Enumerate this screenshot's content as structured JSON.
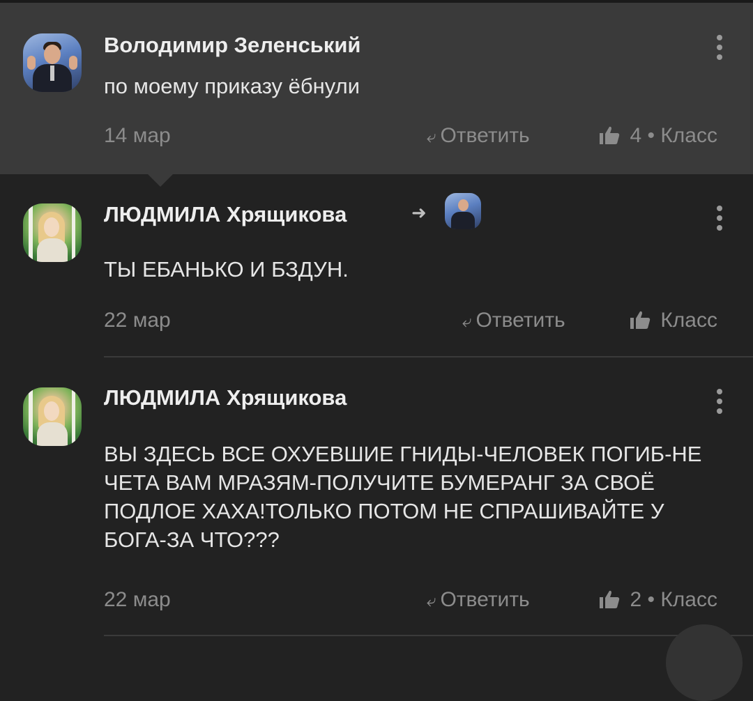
{
  "comments": [
    {
      "author": "Володимир Зеленський",
      "text": "по моему приказу ёбнули",
      "date": "14 мар",
      "reply_label": "Ответить",
      "likes": "4 • Класс"
    },
    {
      "author": "ЛЮДМИЛА Хрящикова",
      "text": "ТЫ ЕБАНЬКО И БЗДУН.",
      "date": "22 мар",
      "reply_label": "Ответить",
      "likes": "Класс"
    },
    {
      "author": "ЛЮДМИЛА Хрящикова",
      "text": "ВЫ ЗДЕСЬ ВСЕ ОХУЕВШИЕ ГНИДЫ-ЧЕЛОВЕК ПОГИБ-НЕ ЧЕТА ВАМ МРАЗЯМ-ПОЛУЧИТЕ БУМЕРАНГ ЗА СВОЁ ПОДЛОЕ ХАХА!ТОЛЬКО ПОТОМ НЕ СПРАШИВАЙТЕ У БОГА-ЗА ЧТО???",
      "date": "22 мар",
      "reply_label": "Ответить",
      "likes": "2 • Класс"
    }
  ],
  "icons": {
    "reply": "reply-arrow-icon",
    "like": "thumbs-up-icon",
    "more": "more-vertical-icon",
    "reply_to": "reply-to-arrow-icon"
  },
  "colors": {
    "background": "#222222",
    "highlight": "#3a3a3a",
    "text": "#e6e6e6",
    "muted": "#8c8c8c"
  }
}
